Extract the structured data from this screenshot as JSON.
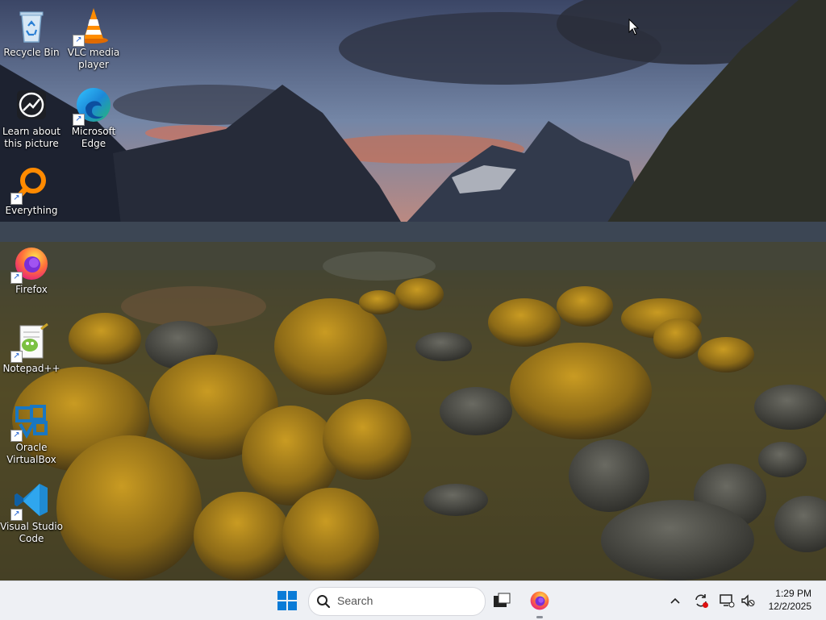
{
  "desktop": {
    "icons": [
      {
        "id": "recycle-bin",
        "label": "Recycle Bin",
        "shortcut": false
      },
      {
        "id": "vlc",
        "label": "VLC media player",
        "shortcut": true
      },
      {
        "id": "learn-picture",
        "label": "Learn about this picture",
        "shortcut": false
      },
      {
        "id": "edge",
        "label": "Microsoft Edge",
        "shortcut": true
      },
      {
        "id": "everything",
        "label": "Everything",
        "shortcut": true
      },
      {
        "id": "firefox",
        "label": "Firefox",
        "shortcut": true
      },
      {
        "id": "notepadpp",
        "label": "Notepad++",
        "shortcut": true
      },
      {
        "id": "virtualbox",
        "label": "Oracle VirtualBox",
        "shortcut": true
      },
      {
        "id": "vscode",
        "label": "Visual Studio Code",
        "shortcut": true
      }
    ]
  },
  "taskbar": {
    "search_placeholder": "Search",
    "pinned": [
      "start-button",
      "search-box",
      "task-view",
      "firefox"
    ],
    "tray": [
      "show-hidden-icons",
      "update-icon",
      "network-icon",
      "volume-icon"
    ],
    "time": "1:29 PM",
    "date": "12/2/2025"
  },
  "colors": {
    "taskbar_bg": "#eef0f4",
    "windows_blue": "#0a7bd7",
    "firefox_orange": "#ff7139"
  }
}
